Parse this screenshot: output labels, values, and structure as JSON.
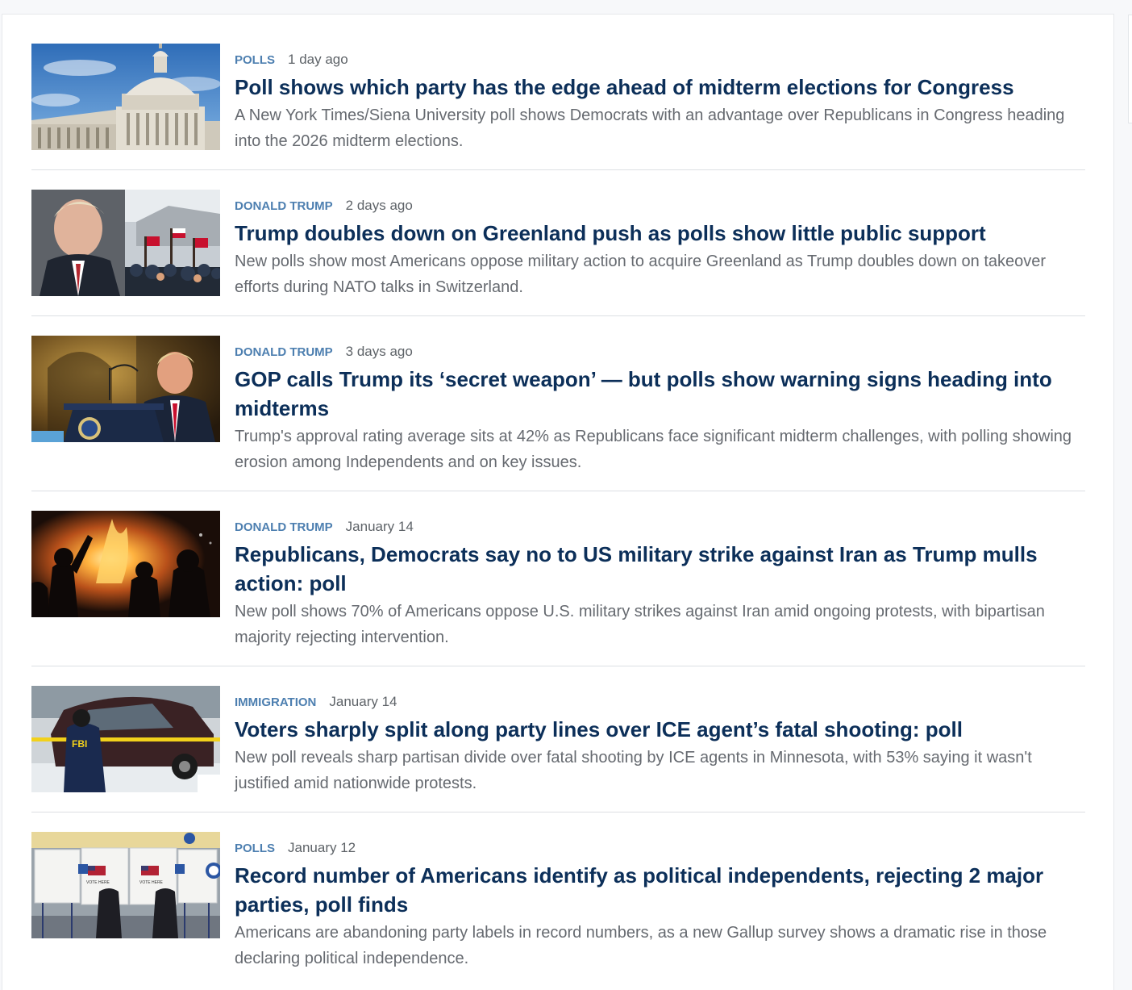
{
  "articles": [
    {
      "category": "POLLS",
      "date": "1 day ago",
      "headline": "Poll shows which party has the edge ahead of midterm elections for Congress",
      "summary": "A New York Times/Siena University poll shows Democrats with an advantage over Republicans in Congress heading into the 2026 midterm elections.",
      "image": "capitol-dome-image"
    },
    {
      "category": "DONALD TRUMP",
      "date": "2 days ago",
      "headline": "Trump doubles down on Greenland push as polls show little public support",
      "summary": "New polls show most Americans oppose military action to acquire Greenland as Trump doubles down on takeover efforts during NATO talks in Switzerland.",
      "image": "trump-greenland-protest-image"
    },
    {
      "category": "DONALD TRUMP",
      "date": "3 days ago",
      "headline": "GOP calls Trump its ‘secret weapon’ — but polls show warning signs heading into midterms",
      "summary": "Trump's approval rating average sits at 42% as Republicans face significant midterm challenges, with polling showing erosion among Independents and on key issues.",
      "image": "trump-podium-image"
    },
    {
      "category": "DONALD TRUMP",
      "date": "January 14",
      "headline": "Republicans, Democrats say no to US military strike against Iran as Trump mulls action: poll",
      "summary": "New poll shows 70% of Americans oppose U.S. military strikes against Iran amid ongoing protests, with bipartisan majority rejecting intervention.",
      "image": "iran-protest-fire-image"
    },
    {
      "category": "IMMIGRATION",
      "date": "January 14",
      "headline": "Voters sharply split along party lines over ICE agent’s fatal shooting: poll",
      "summary": "New poll reveals sharp partisan divide over fatal shooting by ICE agents in Minnesota, with 53% saying it wasn't justified amid nationwide protests.",
      "image": "fbi-crime-scene-image"
    },
    {
      "category": "POLLS",
      "date": "January 12",
      "headline": "Record number of Americans identify as political independents, rejecting 2 major parties, poll finds",
      "summary": "Americans are abandoning party labels in record numbers, as a new Gallup survey shows a dramatic rise in those declaring political independence.",
      "image": "voting-booths-image"
    }
  ],
  "thumb_text": {
    "fbi": "FBI",
    "vote_here": "VOTE HERE"
  },
  "colors": {
    "category": "#4d7fb0",
    "headline": "#0c2f59",
    "summary": "#666a70",
    "date": "#5e6368",
    "divider": "#dcdfe3"
  }
}
